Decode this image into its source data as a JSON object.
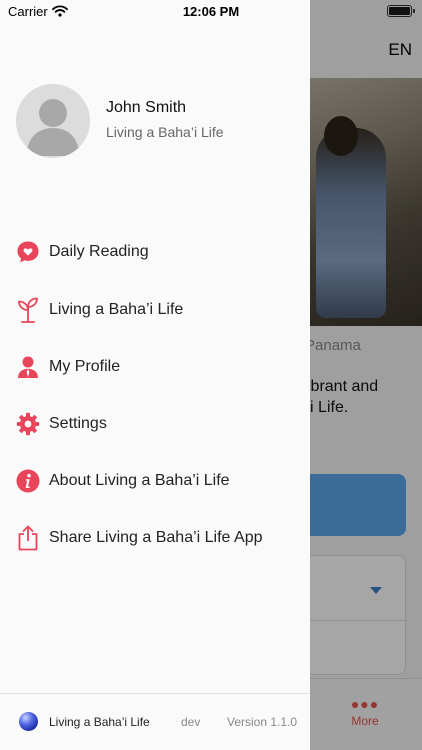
{
  "status_bar": {
    "carrier": "Carrier",
    "time": "12:06 PM"
  },
  "background": {
    "language": "EN",
    "photo_caption": "Panama",
    "text_line1": "ibrant and",
    "text_line2": "'i Life.",
    "tab_more_label": "More"
  },
  "drawer": {
    "user": {
      "name": "John Smith",
      "subtitle": "Living a Baha’i Life"
    },
    "menu": [
      {
        "label": "Daily Reading",
        "icon": "heart-chat-icon"
      },
      {
        "label": "Living a Baha’i Life",
        "icon": "sprout-icon"
      },
      {
        "label": "My Profile",
        "icon": "person-icon"
      },
      {
        "label": "Settings",
        "icon": "gear-icon"
      },
      {
        "label": "About Living a Baha’i Life",
        "icon": "info-icon"
      },
      {
        "label": "Share Living a Baha’i Life App",
        "icon": "share-icon"
      }
    ],
    "footer": {
      "app_name": "Living a Baha’i Life",
      "env": "dev",
      "version": "Version 1.1.0"
    }
  },
  "colors": {
    "accent": "#e8455b",
    "tab_accent": "#e5534b",
    "bg_button": "#5aa7e8"
  }
}
